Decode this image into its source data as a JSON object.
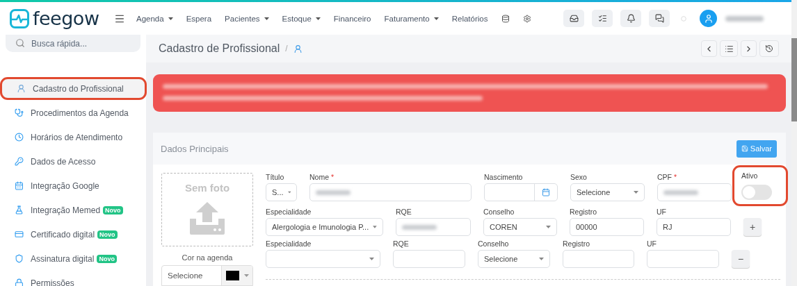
{
  "brand": {
    "name": "feegow"
  },
  "top_nav": [
    {
      "label": "Agenda",
      "dropdown": true
    },
    {
      "label": "Espera",
      "dropdown": false
    },
    {
      "label": "Pacientes",
      "dropdown": true
    },
    {
      "label": "Estoque",
      "dropdown": true
    },
    {
      "label": "Financeiro",
      "dropdown": false
    },
    {
      "label": "Faturamento",
      "dropdown": true
    },
    {
      "label": "Relatórios",
      "dropdown": false
    }
  ],
  "search": {
    "placeholder": "Busca rápida..."
  },
  "sidebar": {
    "items": [
      {
        "label": "Cadastro do Profissional",
        "selected": true,
        "highlighted": true
      },
      {
        "label": "Procedimentos da Agenda",
        "selected": false,
        "highlighted": false
      },
      {
        "label": "Horários de Atendimento",
        "selected": false,
        "highlighted": false
      },
      {
        "label": "Dados de Acesso",
        "selected": false,
        "highlighted": false
      },
      {
        "label": "Integração Google",
        "selected": false,
        "highlighted": false
      },
      {
        "label": "Integração Memed",
        "selected": false,
        "highlighted": false,
        "badge": "Novo"
      },
      {
        "label": "Certificado digital",
        "selected": false,
        "highlighted": false,
        "badge": "Novo"
      },
      {
        "label": "Assinatura digital",
        "selected": false,
        "highlighted": false,
        "badge": "Novo"
      },
      {
        "label": "Permissões",
        "selected": false,
        "highlighted": false
      }
    ]
  },
  "page": {
    "title": "Cadastro de Profissional",
    "separator": "/"
  },
  "card": {
    "title": "Dados Principais",
    "save_button": "Salvar",
    "photo": {
      "label": "Sem foto"
    },
    "agenda_color": {
      "label": "Cor na agenda",
      "value": "Selecione",
      "color": "#000000"
    },
    "rows": [
      [
        {
          "kind": "select",
          "label": "Título",
          "value": "S..."
        },
        {
          "kind": "text",
          "label": "Nome",
          "required_mark": "*",
          "redacted": true
        },
        {
          "kind": "date",
          "label": "Nascimento"
        },
        {
          "kind": "select",
          "label": "Sexo",
          "value": "Selecione"
        },
        {
          "kind": "text",
          "label": "CPF",
          "required_mark": "*",
          "redacted": true
        },
        {
          "kind": "toggle",
          "label": "Ativo",
          "on": false,
          "highlighted": true
        }
      ],
      [
        {
          "kind": "select",
          "label": "Especialidade",
          "value": "Alergologia e Imunologia P..."
        },
        {
          "kind": "text",
          "label": "RQE",
          "redacted": true
        },
        {
          "kind": "select",
          "label": "Conselho",
          "value": "COREN"
        },
        {
          "kind": "text",
          "label": "Registro",
          "value": "00000"
        },
        {
          "kind": "text",
          "label": "UF",
          "value": "RJ"
        },
        {
          "kind": "button",
          "label": "+"
        }
      ],
      [
        {
          "kind": "select",
          "label": "Especialidade"
        },
        {
          "kind": "text",
          "label": "RQE"
        },
        {
          "kind": "select",
          "label": "Conselho",
          "value": "Selecione"
        },
        {
          "kind": "text",
          "label": "Registro"
        },
        {
          "kind": "text",
          "label": "UF"
        },
        {
          "kind": "button",
          "label": "−"
        }
      ]
    ]
  }
}
